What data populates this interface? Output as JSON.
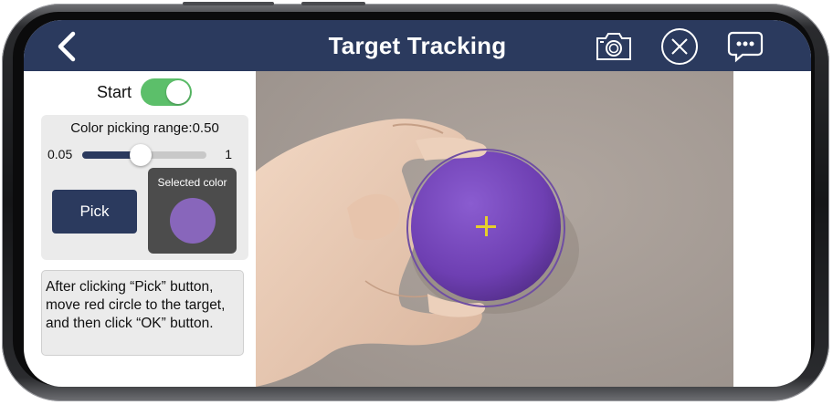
{
  "header": {
    "title": "Target Tracking",
    "icons": [
      "back-arrow-icon",
      "camera-icon",
      "close-circle-icon",
      "chat-bubble-icon"
    ]
  },
  "controls": {
    "start_label": "Start",
    "start_on": true,
    "range_label": "Color picking range:0.50",
    "slider": {
      "min_label": "0.05",
      "max_label": "1",
      "min": 0.05,
      "max": 1,
      "value": 0.5
    },
    "pick_label": "Pick",
    "selected_color_label": "Selected color",
    "selected_color": "#8866bb"
  },
  "instructions": "After clicking “Pick” button, move red circle to the target, and then click “OK” button.",
  "colors": {
    "header_bg": "#2b3a5e",
    "toggle_on": "#5cbf6a",
    "target_circle": "#6f4ea3",
    "crosshair": "#e6cf2a",
    "ball": "#7d4cc0"
  }
}
